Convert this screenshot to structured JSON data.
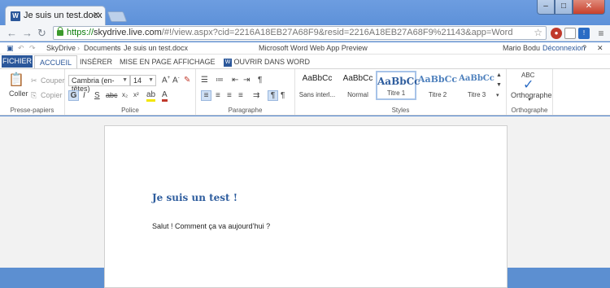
{
  "browser": {
    "tab_title": "Je suis un test.docx - Micro",
    "tab_icon": "W",
    "url_scheme": "https://",
    "url_host": "skydrive.live.com",
    "url_rest": "/#!/view.aspx?cid=2216A18EB27A68F9&resid=2216A18EB27A68F9%21143&app=Word",
    "window_buttons": {
      "minimize": "–",
      "maximize": "□",
      "close": "✕"
    }
  },
  "appbar": {
    "breadcrumb": [
      "SkyDrive",
      "Documents",
      "Je suis un test.docx"
    ],
    "app_title": "Microsoft Word Web App Preview",
    "user": "Mario Bodu",
    "signout": "Déconnexion",
    "help": "?"
  },
  "ribbon_tabs": {
    "file": "FICHIER",
    "tabs": [
      "ACCUEIL",
      "INSÉRER",
      "MISE EN PAGE",
      "AFFICHAGE"
    ],
    "open_in_word": "OUVRIR DANS WORD"
  },
  "ribbon": {
    "clipboard": {
      "paste": "Coller",
      "cut": "Couper",
      "copy": "Copier",
      "label": "Presse-papiers"
    },
    "font": {
      "name": "Cambria (en-têtes)",
      "size": "14",
      "label": "Police"
    },
    "paragraph": {
      "label": "Paragraphe"
    },
    "styles": {
      "label": "Styles",
      "items": [
        {
          "sample": "AaBbCc",
          "name": "Sans interl..."
        },
        {
          "sample": "AaBbCc",
          "name": "Normal"
        },
        {
          "sample": "AaBbCc",
          "name": "Titre 1"
        },
        {
          "sample": "AaBbCc",
          "name": "Titre 2"
        },
        {
          "sample": "AaBbCc",
          "name": "Titre 3"
        }
      ]
    },
    "spelling": {
      "abc": "ABC",
      "button": "Orthographe",
      "label": "Orthographe"
    }
  },
  "document": {
    "title": "Je suis un test !",
    "body": "Salut ! Comment ça va aujourd’hui ?"
  },
  "colors": {
    "accent": "#2b579a",
    "heading": "#2e5d9e",
    "chrome": "#5c8fd1"
  }
}
